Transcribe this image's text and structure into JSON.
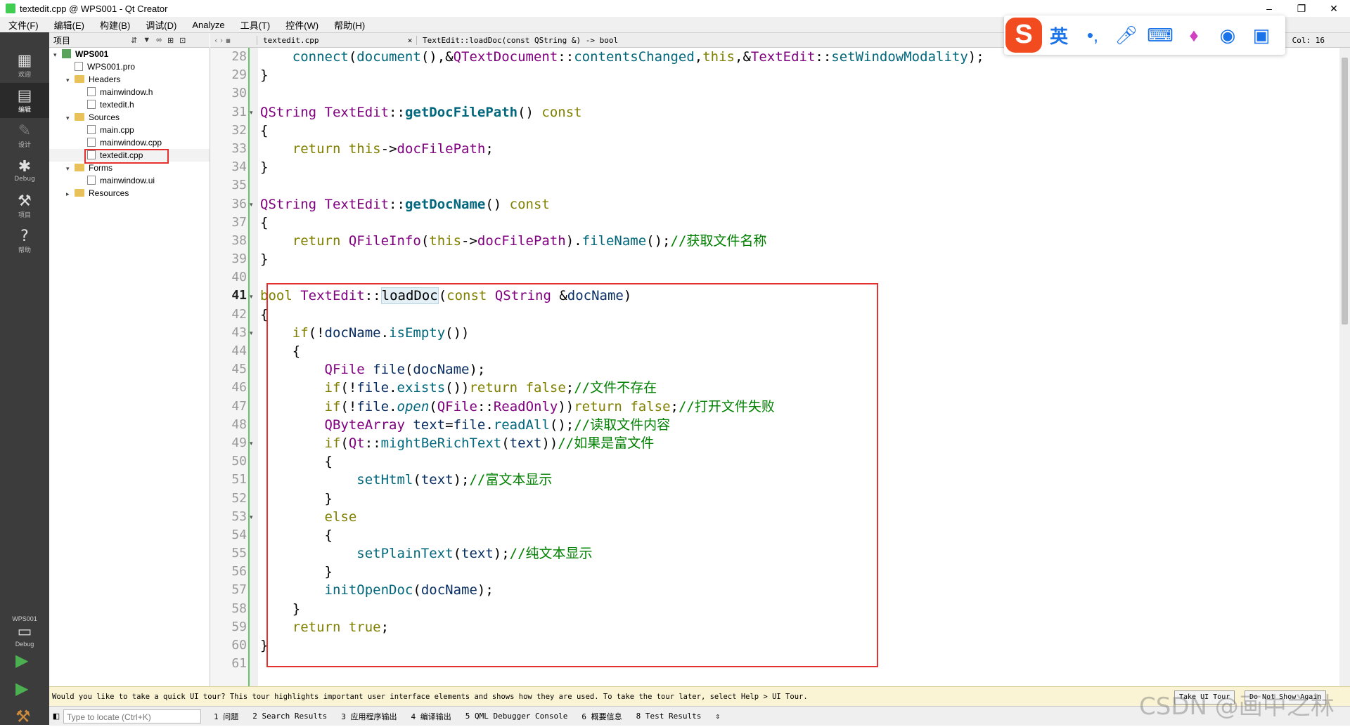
{
  "window": {
    "title": "textedit.cpp @ WPS001 - Qt Creator",
    "minimize": "–",
    "maximize": "❐",
    "close": "✕"
  },
  "menu": [
    "文件(F)",
    "编辑(E)",
    "构建(B)",
    "调试(D)",
    "Analyze",
    "工具(T)",
    "控件(W)",
    "帮助(H)"
  ],
  "modes": [
    {
      "label": "欢迎",
      "icon": "grid-icon"
    },
    {
      "label": "编辑",
      "icon": "edit-icon"
    },
    {
      "label": "设计",
      "icon": "pen-icon"
    },
    {
      "label": "Debug",
      "icon": "bug-icon"
    },
    {
      "label": "项目",
      "icon": "wrench-icon"
    },
    {
      "label": "帮助",
      "icon": "help-icon"
    }
  ],
  "kit": {
    "project": "WPS001",
    "mode": "Debug"
  },
  "project_panel": {
    "title": "项目"
  },
  "tree": [
    {
      "label": "WPS001",
      "level": 0,
      "kind": "project",
      "arrow": "▾"
    },
    {
      "label": "WPS001.pro",
      "level": 1,
      "kind": "file",
      "arrow": ""
    },
    {
      "label": "Headers",
      "level": 1,
      "kind": "folder",
      "arrow": "▾"
    },
    {
      "label": "mainwindow.h",
      "level": 2,
      "kind": "file",
      "arrow": ""
    },
    {
      "label": "textedit.h",
      "level": 2,
      "kind": "file",
      "arrow": ""
    },
    {
      "label": "Sources",
      "level": 1,
      "kind": "folder",
      "arrow": "▾"
    },
    {
      "label": "main.cpp",
      "level": 2,
      "kind": "file",
      "arrow": ""
    },
    {
      "label": "mainwindow.cpp",
      "level": 2,
      "kind": "file",
      "arrow": ""
    },
    {
      "label": "textedit.cpp",
      "level": 2,
      "kind": "file",
      "arrow": "",
      "selected": true
    },
    {
      "label": "Forms",
      "level": 1,
      "kind": "folder",
      "arrow": "▾"
    },
    {
      "label": "mainwindow.ui",
      "level": 2,
      "kind": "file",
      "arrow": ""
    },
    {
      "label": "Resources",
      "level": 1,
      "kind": "folder",
      "arrow": "▸"
    }
  ],
  "editor_header": {
    "file": "textedit.cpp",
    "symbol": "TextEdit::loadDoc(const QString &) -> bool",
    "column": "Col: 16"
  },
  "code": {
    "current_line": 41,
    "lines": [
      {
        "n": 28,
        "fold": "",
        "segs": [
          [
            "    ",
            ""
          ],
          [
            "connect",
            "fn"
          ],
          [
            "(",
            ""
          ],
          [
            "document",
            "fn"
          ],
          [
            "(),&",
            ""
          ],
          [
            "QTextDocument",
            "ty"
          ],
          [
            "::",
            ""
          ],
          [
            "contentsChanged",
            "fn"
          ],
          [
            ",",
            ""
          ],
          [
            "this",
            "kw"
          ],
          [
            ",&",
            ""
          ],
          [
            "TextEdit",
            "ty"
          ],
          [
            "::",
            ""
          ],
          [
            "setWindowModality",
            "fn"
          ],
          [
            ");",
            ""
          ]
        ]
      },
      {
        "n": 29,
        "fold": "",
        "segs": [
          [
            "}",
            ""
          ]
        ]
      },
      {
        "n": 30,
        "fold": "",
        "segs": []
      },
      {
        "n": 31,
        "fold": "▾",
        "segs": [
          [
            "QString",
            "ty"
          ],
          [
            " ",
            ""
          ],
          [
            "TextEdit",
            "ty"
          ],
          [
            "::",
            ""
          ],
          [
            "getDocFilePath",
            "fnb"
          ],
          [
            "() ",
            ""
          ],
          [
            "const",
            "kw"
          ]
        ]
      },
      {
        "n": 32,
        "fold": "",
        "segs": [
          [
            "{",
            ""
          ]
        ]
      },
      {
        "n": 33,
        "fold": "",
        "segs": [
          [
            "    ",
            ""
          ],
          [
            "return",
            "kw"
          ],
          [
            " ",
            ""
          ],
          [
            "this",
            "kw"
          ],
          [
            "->",
            ""
          ],
          [
            "docFilePath",
            "ty"
          ],
          [
            ";",
            ""
          ]
        ]
      },
      {
        "n": 34,
        "fold": "",
        "segs": [
          [
            "}",
            ""
          ]
        ]
      },
      {
        "n": 35,
        "fold": "",
        "segs": []
      },
      {
        "n": 36,
        "fold": "▾",
        "segs": [
          [
            "QString",
            "ty"
          ],
          [
            " ",
            ""
          ],
          [
            "TextEdit",
            "ty"
          ],
          [
            "::",
            ""
          ],
          [
            "getDocName",
            "fnb"
          ],
          [
            "() ",
            ""
          ],
          [
            "const",
            "kw"
          ]
        ]
      },
      {
        "n": 37,
        "fold": "",
        "segs": [
          [
            "{",
            ""
          ]
        ]
      },
      {
        "n": 38,
        "fold": "",
        "segs": [
          [
            "    ",
            ""
          ],
          [
            "return",
            "kw"
          ],
          [
            " ",
            ""
          ],
          [
            "QFileInfo",
            "ty"
          ],
          [
            "(",
            ""
          ],
          [
            "this",
            "kw"
          ],
          [
            "->",
            ""
          ],
          [
            "docFilePath",
            "ty"
          ],
          [
            ").",
            ""
          ],
          [
            "fileName",
            "fn"
          ],
          [
            "();",
            ""
          ],
          [
            "//获取文件名称",
            "cm"
          ]
        ]
      },
      {
        "n": 39,
        "fold": "",
        "segs": [
          [
            "}",
            ""
          ]
        ]
      },
      {
        "n": 40,
        "fold": "",
        "segs": []
      },
      {
        "n": 41,
        "fold": "▾",
        "segs": [
          [
            "bool",
            "kw"
          ],
          [
            " ",
            ""
          ],
          [
            "TextEdit",
            "ty"
          ],
          [
            "::",
            ""
          ],
          [
            "loadDoc",
            "hl"
          ],
          [
            "(",
            ""
          ],
          [
            "const",
            "kw"
          ],
          [
            " ",
            ""
          ],
          [
            "QString",
            "ty"
          ],
          [
            " &",
            ""
          ],
          [
            "docName",
            "pm"
          ],
          [
            ")",
            ""
          ]
        ]
      },
      {
        "n": 42,
        "fold": "",
        "segs": [
          [
            "{",
            ""
          ]
        ]
      },
      {
        "n": 43,
        "fold": "▾",
        "segs": [
          [
            "    ",
            ""
          ],
          [
            "if",
            "kw"
          ],
          [
            "(!",
            ""
          ],
          [
            "docName",
            "pm"
          ],
          [
            ".",
            ""
          ],
          [
            "isEmpty",
            "fn"
          ],
          [
            "())",
            ""
          ]
        ]
      },
      {
        "n": 44,
        "fold": "",
        "segs": [
          [
            "    {",
            ""
          ]
        ]
      },
      {
        "n": 45,
        "fold": "",
        "segs": [
          [
            "        ",
            ""
          ],
          [
            "QFile",
            "ty"
          ],
          [
            " ",
            ""
          ],
          [
            "file",
            "pm"
          ],
          [
            "(",
            ""
          ],
          [
            "docName",
            "pm"
          ],
          [
            ");",
            ""
          ]
        ]
      },
      {
        "n": 46,
        "fold": "",
        "segs": [
          [
            "        ",
            ""
          ],
          [
            "if",
            "kw"
          ],
          [
            "(!",
            ""
          ],
          [
            "file",
            "pm"
          ],
          [
            ".",
            ""
          ],
          [
            "exists",
            "fn"
          ],
          [
            "())",
            ""
          ],
          [
            "return",
            "kw"
          ],
          [
            " ",
            ""
          ],
          [
            "false",
            "kw"
          ],
          [
            ";",
            ""
          ],
          [
            "//文件不存在",
            "cm"
          ]
        ]
      },
      {
        "n": 47,
        "fold": "",
        "segs": [
          [
            "        ",
            ""
          ],
          [
            "if",
            "kw"
          ],
          [
            "(!",
            ""
          ],
          [
            "file",
            "pm"
          ],
          [
            ".",
            ""
          ],
          [
            "open",
            "it"
          ],
          [
            "(",
            ""
          ],
          [
            "QFile",
            "ty"
          ],
          [
            "::",
            ""
          ],
          [
            "ReadOnly",
            "ty"
          ],
          [
            "))",
            ""
          ],
          [
            "return",
            "kw"
          ],
          [
            " ",
            ""
          ],
          [
            "false",
            "kw"
          ],
          [
            ";",
            ""
          ],
          [
            "//打开文件失败",
            "cm"
          ]
        ]
      },
      {
        "n": 48,
        "fold": "",
        "segs": [
          [
            "        ",
            ""
          ],
          [
            "QByteArray",
            "ty"
          ],
          [
            " ",
            ""
          ],
          [
            "text",
            "pm"
          ],
          [
            "=",
            ""
          ],
          [
            "file",
            "pm"
          ],
          [
            ".",
            ""
          ],
          [
            "readAll",
            "fn"
          ],
          [
            "();",
            ""
          ],
          [
            "//读取文件内容",
            "cm"
          ]
        ]
      },
      {
        "n": 49,
        "fold": "▾",
        "segs": [
          [
            "        ",
            ""
          ],
          [
            "if",
            "kw"
          ],
          [
            "(",
            ""
          ],
          [
            "Qt",
            "ty"
          ],
          [
            "::",
            ""
          ],
          [
            "mightBeRichText",
            "fn"
          ],
          [
            "(",
            ""
          ],
          [
            "text",
            "pm"
          ],
          [
            "))",
            ""
          ],
          [
            "//如果是富文件",
            "cm"
          ]
        ]
      },
      {
        "n": 50,
        "fold": "",
        "segs": [
          [
            "        {",
            ""
          ]
        ]
      },
      {
        "n": 51,
        "fold": "",
        "segs": [
          [
            "            ",
            ""
          ],
          [
            "setHtml",
            "fn"
          ],
          [
            "(",
            ""
          ],
          [
            "text",
            "pm"
          ],
          [
            ");",
            ""
          ],
          [
            "//富文本显示",
            "cm"
          ]
        ]
      },
      {
        "n": 52,
        "fold": "",
        "segs": [
          [
            "        }",
            ""
          ]
        ]
      },
      {
        "n": 53,
        "fold": "▾",
        "segs": [
          [
            "        ",
            ""
          ],
          [
            "else",
            "kw"
          ]
        ]
      },
      {
        "n": 54,
        "fold": "",
        "segs": [
          [
            "        {",
            ""
          ]
        ]
      },
      {
        "n": 55,
        "fold": "",
        "segs": [
          [
            "            ",
            ""
          ],
          [
            "setPlainText",
            "fn"
          ],
          [
            "(",
            ""
          ],
          [
            "text",
            "pm"
          ],
          [
            ");",
            ""
          ],
          [
            "//纯文本显示",
            "cm"
          ]
        ]
      },
      {
        "n": 56,
        "fold": "",
        "segs": [
          [
            "        }",
            ""
          ]
        ]
      },
      {
        "n": 57,
        "fold": "",
        "segs": [
          [
            "        ",
            ""
          ],
          [
            "initOpenDoc",
            "fn"
          ],
          [
            "(",
            ""
          ],
          [
            "docName",
            "pm"
          ],
          [
            ");",
            ""
          ]
        ]
      },
      {
        "n": 58,
        "fold": "",
        "segs": [
          [
            "    }",
            ""
          ]
        ]
      },
      {
        "n": 59,
        "fold": "",
        "segs": [
          [
            "    ",
            ""
          ],
          [
            "return",
            "kw"
          ],
          [
            " ",
            ""
          ],
          [
            "true",
            "kw"
          ],
          [
            ";",
            ""
          ]
        ]
      },
      {
        "n": 60,
        "fold": "",
        "segs": [
          [
            "}",
            ""
          ]
        ]
      },
      {
        "n": 61,
        "fold": "",
        "segs": []
      }
    ]
  },
  "ime_toolbar": {
    "logo": "S",
    "lang": "英",
    "items": [
      "punct-icon",
      "mic-icon",
      "keyboard-icon",
      "skin-icon",
      "game-icon",
      "apps-icon"
    ]
  },
  "tour": {
    "message": "Would you like to take a quick UI tour? This tour highlights important user interface elements and shows how they are used. To take the tour later, select Help > UI Tour.",
    "take": "Take UI Tour",
    "dont": "Do Not Show Again"
  },
  "status": {
    "locate_placeholder": "Type to locate (Ctrl+K)",
    "panes": [
      "1 问题",
      "2 Search Results",
      "3 应用程序输出",
      "4 编译输出",
      "5 QML Debugger Console",
      "6 概要信息",
      "8 Test Results"
    ]
  },
  "watermark": "CSDN @画中之林"
}
